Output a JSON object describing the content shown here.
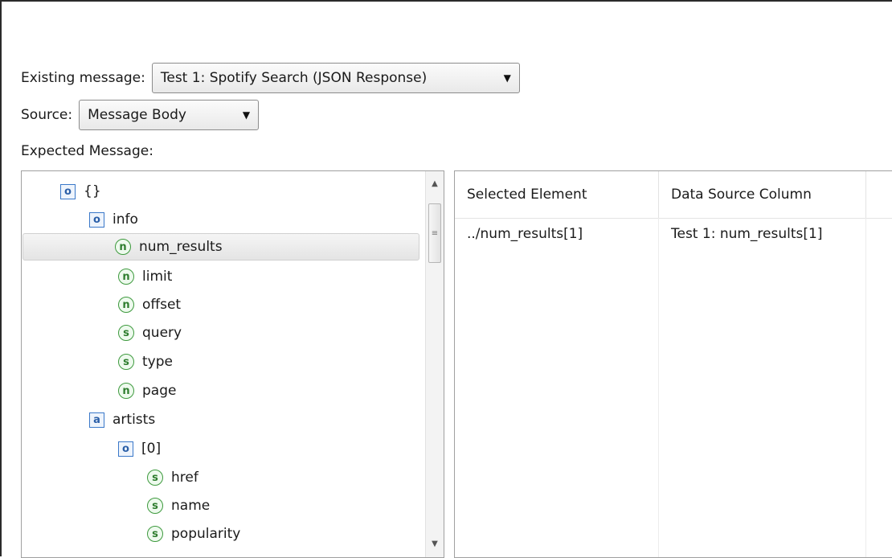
{
  "existing_message": {
    "label": "Existing message:",
    "value": "Test 1:  Spotify Search (JSON Response)"
  },
  "source": {
    "label": "Source:",
    "value": "Message Body"
  },
  "expected_message_label": "Expected Message:",
  "tree": [
    {
      "label": "{}",
      "type": "object",
      "icon": "o"
    },
    {
      "label": "info",
      "type": "object",
      "icon": "o"
    },
    {
      "label": "num_results",
      "type": "number",
      "icon": "n",
      "selected": true
    },
    {
      "label": "limit",
      "type": "number",
      "icon": "n"
    },
    {
      "label": "offset",
      "type": "number",
      "icon": "n"
    },
    {
      "label": "query",
      "type": "string",
      "icon": "s"
    },
    {
      "label": "type",
      "type": "string",
      "icon": "s"
    },
    {
      "label": "page",
      "type": "number",
      "icon": "n"
    },
    {
      "label": "artists",
      "type": "array",
      "icon": "a"
    },
    {
      "label": "[0]",
      "type": "object",
      "icon": "o"
    },
    {
      "label": "href",
      "type": "string",
      "icon": "s"
    },
    {
      "label": "name",
      "type": "string",
      "icon": "s"
    },
    {
      "label": "popularity",
      "type": "string",
      "icon": "s"
    }
  ],
  "table": {
    "headers": [
      "Selected Element",
      "Data Source Column"
    ],
    "rows": [
      [
        "../num_results[1]",
        "Test 1: num_results[1]"
      ]
    ]
  }
}
